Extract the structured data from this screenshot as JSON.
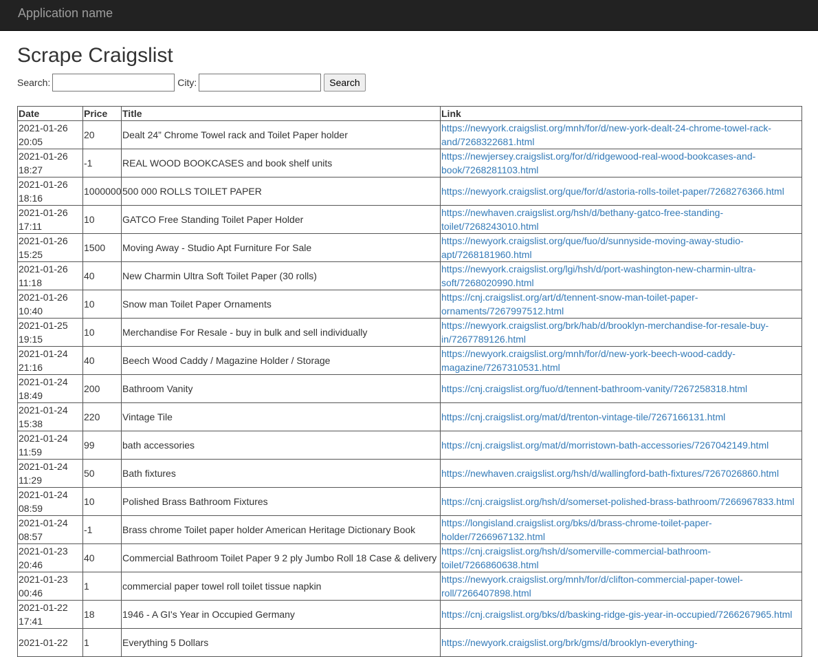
{
  "navbar": {
    "brand": "Application name"
  },
  "page": {
    "title": "Scrape Craigslist"
  },
  "search_form": {
    "search_label": "Search:",
    "search_value": "",
    "city_label": "City:",
    "city_value": "",
    "button_label": "Search"
  },
  "table": {
    "headers": {
      "date": "Date",
      "price": "Price",
      "title": "Title",
      "link": "Link"
    },
    "rows": [
      {
        "date": "2021-01-26 20:05",
        "price": "20",
        "title": "Dealt 24” Chrome Towel rack and Toilet Paper holder",
        "link": "https://newyork.craigslist.org/mnh/for/d/new-york-dealt-24-chrome-towel-rack-and/7268322681.html"
      },
      {
        "date": "2021-01-26 18:27",
        "price": "-1",
        "title": "REAL WOOD BOOKCASES and book shelf units",
        "link": "https://newjersey.craigslist.org/for/d/ridgewood-real-wood-bookcases-and-book/7268281103.html"
      },
      {
        "date": "2021-01-26 18:16",
        "price": "1000000",
        "title": "500 000 ROLLS TOILET PAPER",
        "link": "https://newyork.craigslist.org/que/for/d/astoria-rolls-toilet-paper/7268276366.html"
      },
      {
        "date": "2021-01-26 17:11",
        "price": "10",
        "title": "GATCO Free Standing Toilet Paper Holder",
        "link": "https://newhaven.craigslist.org/hsh/d/bethany-gatco-free-standing-toilet/7268243010.html"
      },
      {
        "date": "2021-01-26 15:25",
        "price": "1500",
        "title": "Moving Away - Studio Apt Furniture For Sale",
        "link": "https://newyork.craigslist.org/que/fuo/d/sunnyside-moving-away-studio-apt/7268181960.html"
      },
      {
        "date": "2021-01-26 11:18",
        "price": "40",
        "title": "New Charmin Ultra Soft Toilet Paper (30 rolls)",
        "link": "https://newyork.craigslist.org/lgi/hsh/d/port-washington-new-charmin-ultra-soft/7268020990.html"
      },
      {
        "date": "2021-01-26 10:40",
        "price": "10",
        "title": "Snow man Toilet Paper Ornaments",
        "link": "https://cnj.craigslist.org/art/d/tennent-snow-man-toilet-paper-ornaments/7267997512.html"
      },
      {
        "date": "2021-01-25 19:15",
        "price": "10",
        "title": "Merchandise For Resale - buy in bulk and sell individually",
        "link": "https://newyork.craigslist.org/brk/hab/d/brooklyn-merchandise-for-resale-buy-in/7267789126.html"
      },
      {
        "date": "2021-01-24 21:16",
        "price": "40",
        "title": "Beech Wood Caddy / Magazine Holder / Storage",
        "link": "https://newyork.craigslist.org/mnh/for/d/new-york-beech-wood-caddy-magazine/7267310531.html"
      },
      {
        "date": "2021-01-24 18:49",
        "price": "200",
        "title": "Bathroom Vanity",
        "link": "https://cnj.craigslist.org/fuo/d/tennent-bathroom-vanity/7267258318.html"
      },
      {
        "date": "2021-01-24 15:38",
        "price": "220",
        "title": "Vintage Tile",
        "link": "https://cnj.craigslist.org/mat/d/trenton-vintage-tile/7267166131.html"
      },
      {
        "date": "2021-01-24 11:59",
        "price": "99",
        "title": "bath accessories",
        "link": "https://cnj.craigslist.org/mat/d/morristown-bath-accessories/7267042149.html"
      },
      {
        "date": "2021-01-24 11:29",
        "price": "50",
        "title": "Bath fixtures",
        "link": "https://newhaven.craigslist.org/hsh/d/wallingford-bath-fixtures/7267026860.html"
      },
      {
        "date": "2021-01-24 08:59",
        "price": "10",
        "title": "Polished Brass Bathroom Fixtures",
        "link": "https://cnj.craigslist.org/hsh/d/somerset-polished-brass-bathroom/7266967833.html"
      },
      {
        "date": "2021-01-24 08:57",
        "price": "-1",
        "title": "Brass chrome Toilet paper holder American Heritage Dictionary Book",
        "link": "https://longisland.craigslist.org/bks/d/brass-chrome-toilet-paper-holder/7266967132.html"
      },
      {
        "date": "2021-01-23 20:46",
        "price": "40",
        "title": "Commercial Bathroom Toilet Paper 9 2 ply Jumbo Roll 18 Case & delivery",
        "link": "https://cnj.craigslist.org/hsh/d/somerville-commercial-bathroom-toilet/7266860638.html"
      },
      {
        "date": "2021-01-23 00:46",
        "price": "1",
        "title": "commercial paper towel roll toilet tissue napkin",
        "link": "https://newyork.craigslist.org/mnh/for/d/clifton-commercial-paper-towel-roll/7266407898.html"
      },
      {
        "date": "2021-01-22 17:41",
        "price": "18",
        "title": "1946 - A GI's Year in Occupied Germany",
        "link": "https://cnj.craigslist.org/bks/d/basking-ridge-gis-year-in-occupied/7266267965.html"
      },
      {
        "date": "2021-01-22",
        "price": "1",
        "title": "Everything 5 Dollars",
        "link": "https://newyork.craigslist.org/brk/gms/d/brooklyn-everything-"
      }
    ]
  }
}
